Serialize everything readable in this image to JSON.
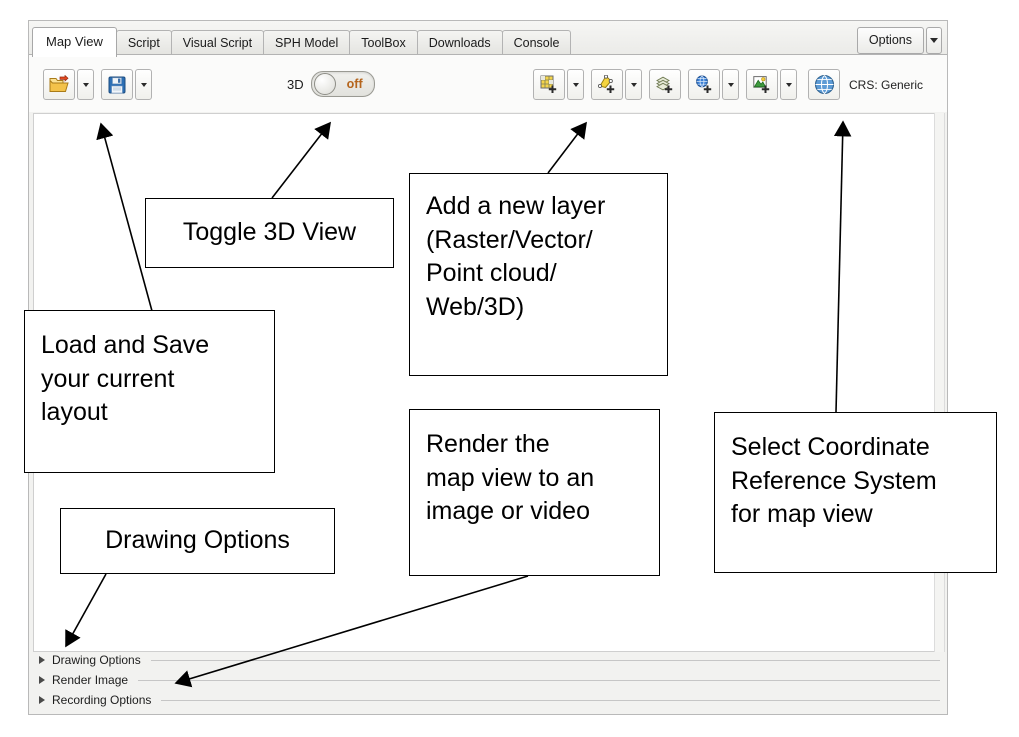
{
  "tabs": [
    {
      "label": "Map View",
      "active": true
    },
    {
      "label": "Script",
      "active": false
    },
    {
      "label": "Visual Script",
      "active": false
    },
    {
      "label": "SPH Model",
      "active": false
    },
    {
      "label": "ToolBox",
      "active": false
    },
    {
      "label": "Downloads",
      "active": false
    },
    {
      "label": "Console",
      "active": false
    }
  ],
  "options_button": {
    "label": "Options",
    "dropdown_icon": "chevron-down-icon"
  },
  "toolbar": {
    "load_layout": {
      "icon": "open-folder-icon",
      "dropdown_icon": "chevron-down-icon"
    },
    "save_layout": {
      "icon": "floppy-disk-save-icon",
      "dropdown_icon": "chevron-down-icon"
    },
    "view_3d": {
      "label": "3D",
      "state": "off",
      "state_label": "off"
    },
    "add_raster_layer": {
      "icon": "add-raster-grid-icon",
      "dropdown_icon": "chevron-down-icon"
    },
    "add_vector_layer": {
      "icon": "add-vector-star-icon",
      "dropdown_icon": "chevron-down-icon"
    },
    "add_point_cloud_layer": {
      "icon": "add-point-cloud-icon"
    },
    "add_web_layer": {
      "icon": "add-web-globe-icon",
      "dropdown_icon": "chevron-down-icon"
    },
    "add_3d_layer": {
      "icon": "add-terrain-mountain-icon",
      "dropdown_icon": "chevron-down-icon"
    },
    "crs_button": {
      "icon": "globe-icon"
    },
    "crs_status": "CRS: Generic"
  },
  "sections": [
    {
      "label": "Drawing Options",
      "expander_icon": "triangle-right-icon"
    },
    {
      "label": "Render Image",
      "expander_icon": "triangle-right-icon"
    },
    {
      "label": "Recording Options",
      "expander_icon": "triangle-right-icon"
    }
  ],
  "annotations": {
    "toggle_3d": "Toggle 3D View",
    "add_layer": "Add a new layer (Raster/Vector/ Point cloud/ Web/3D)",
    "add_layer_lines": [
      "Add a new layer",
      "(Raster/Vector/",
      "Point cloud/",
      "Web/3D)"
    ],
    "load_save": "Load and Save your current layout",
    "load_save_lines": [
      "Load and Save",
      "your current",
      "layout"
    ],
    "render": "Render the map view to an image or video",
    "render_lines": [
      "Render the",
      "map view to an",
      "image or video"
    ],
    "crs": "Select Coordinate Reference System for map view",
    "crs_lines": [
      "Select Coordinate",
      "Reference System",
      "for map view"
    ],
    "drawing_options": "Drawing Options"
  },
  "colors": {
    "annotation_border": "#000000",
    "toggle_text": "#b5651d",
    "panel_background": "#f2f2f0",
    "canvas_background": "#ffffff"
  }
}
